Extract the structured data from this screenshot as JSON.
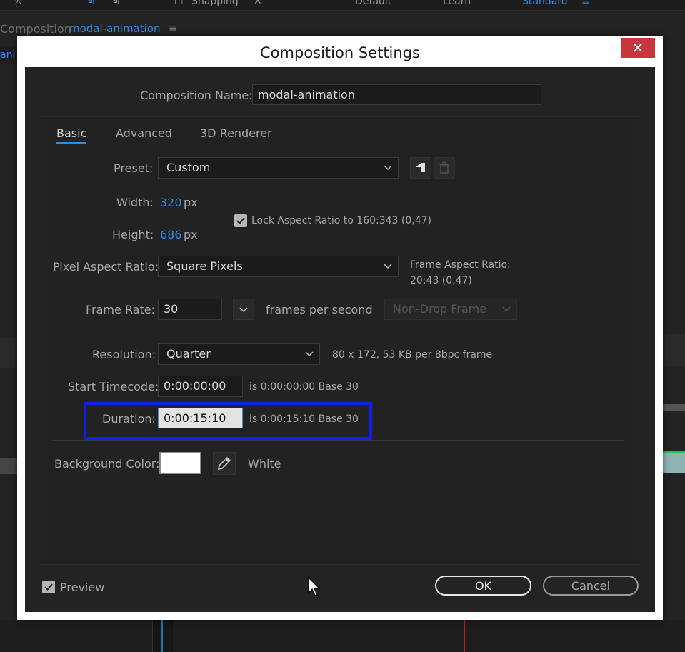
{
  "app": {
    "topbar": {
      "snapping": "Snapping",
      "workspace_default": "Default",
      "workspace_learn": "Learn",
      "workspace_standard": "Standard"
    },
    "comp_panel": {
      "label": "Composition",
      "name": "modal-animation",
      "tab_fragment": "ani"
    }
  },
  "dialog": {
    "title": "Composition Settings",
    "close_label": "✕",
    "comp_name_label": "Composition Name:",
    "comp_name_value": "modal-animation",
    "tabs": [
      {
        "label": "Basic",
        "active": true
      },
      {
        "label": "Advanced",
        "active": false
      },
      {
        "label": "3D Renderer",
        "active": false
      }
    ],
    "preset": {
      "label": "Preset:",
      "value": "Custom"
    },
    "width": {
      "label": "Width:",
      "value": "320",
      "unit": "px"
    },
    "height": {
      "label": "Height:",
      "value": "686",
      "unit": "px"
    },
    "lock_aspect": {
      "label": "Lock Aspect Ratio to 160:343 (0,47)",
      "checked": true
    },
    "pixel_aspect": {
      "label": "Pixel Aspect Ratio:",
      "value": "Square Pixels"
    },
    "frame_aspect": {
      "label": "Frame Aspect Ratio:",
      "value": "20:43 (0,47)"
    },
    "frame_rate": {
      "label": "Frame Rate:",
      "value": "30",
      "unit": "frames per second",
      "drop_frame": "Non-Drop Frame"
    },
    "resolution": {
      "label": "Resolution:",
      "value": "Quarter",
      "info": "80 x 172, 53 KB per 8bpc frame"
    },
    "start_timecode": {
      "label": "Start Timecode:",
      "value": "0:00:00:00",
      "info": "is 0:00:00:00  Base 30"
    },
    "duration": {
      "label": "Duration:",
      "value": "0:00:15:10",
      "info": "is 0:00:15:10  Base 30"
    },
    "background_color": {
      "label": "Background Color:",
      "name": "White",
      "color": "#ffffff"
    },
    "preview": {
      "label": "Preview",
      "checked": true
    },
    "ok_label": "OK",
    "cancel_label": "Cancel"
  },
  "colors": {
    "accent": "#2d8ceb",
    "highlight": "#0f1ff0",
    "close": "#c8353a"
  }
}
